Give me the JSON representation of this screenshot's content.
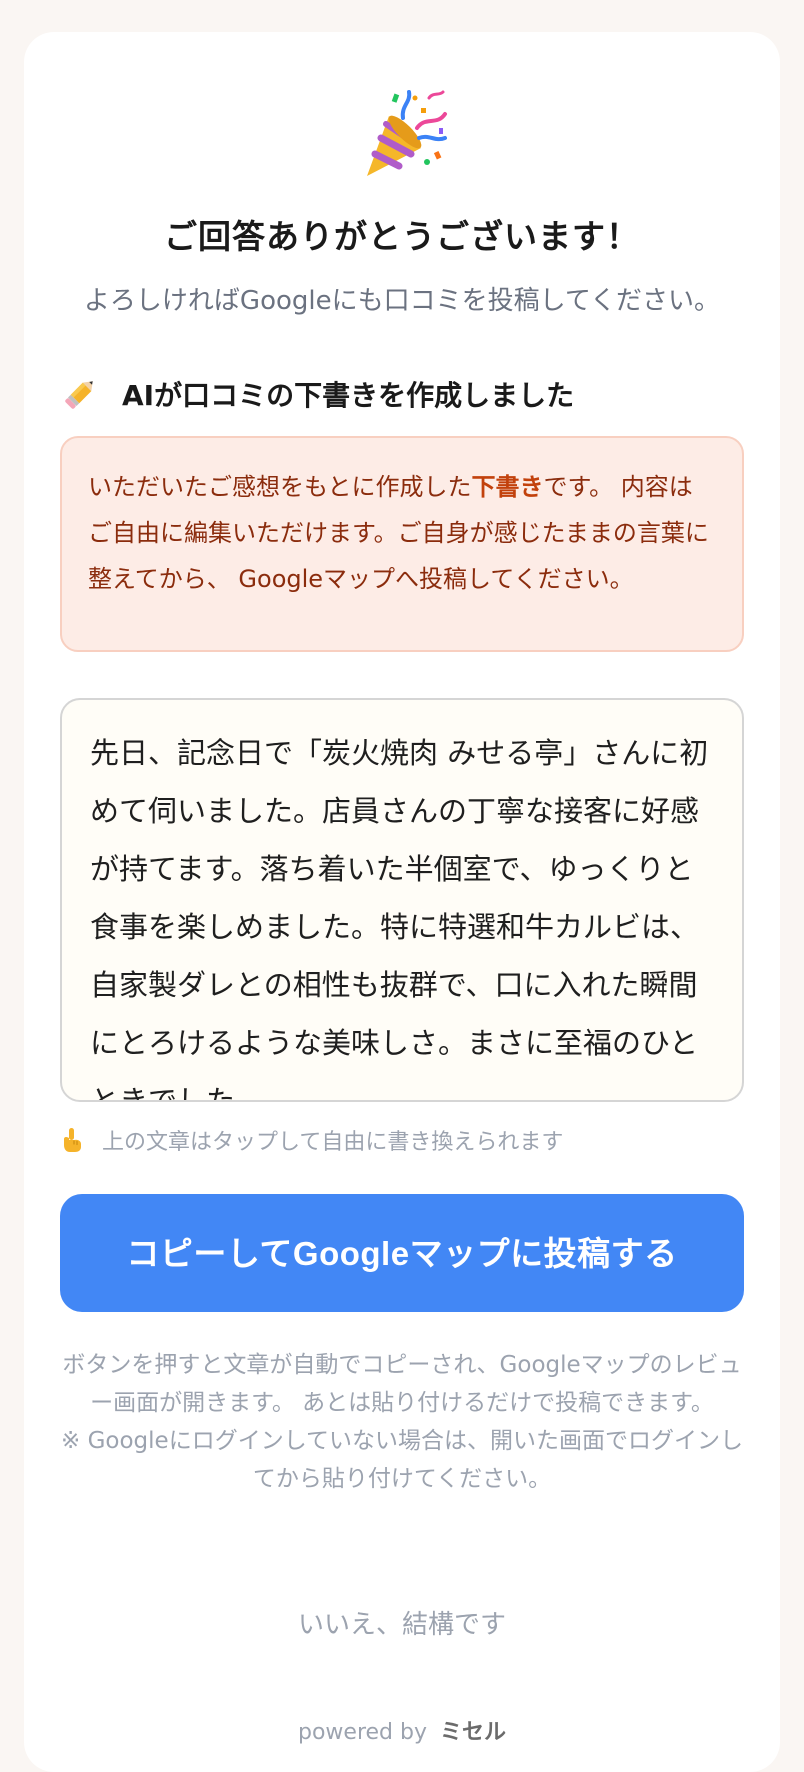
{
  "header": {
    "icon": "party-popper-icon",
    "title": "ご回答ありがとうございます！",
    "subtitle": "よろしければGoogleにも口コミを投稿してください。"
  },
  "section": {
    "icon": "pencil-icon",
    "title": "AIが口コミの下書きを作成しました"
  },
  "notice": {
    "part1": "いただいたご感想をもとに作成した",
    "highlight": "下書き",
    "part2": "です。 内容はご自由に編集いただけます。ご自身が感じたままの言葉に整えてから、 Googleマップへ投稿してください。"
  },
  "draft": {
    "text": "先日、記念日で「炭火焼肉 みせる亭」さんに初めて伺いました。店員さんの丁寧な接客に好感が持てます。落ち着いた半個室で、ゆっくりと食事を楽しめました。特に特選和牛カルビは、自家製ダレとの相性も抜群で、口に入れた瞬間にとろけるような美味しさ。まさに至福のひとときでした。"
  },
  "hint": {
    "icon": "pointing-hand-icon",
    "text": "上の文章はタップして自由に書き換えられます"
  },
  "copy_button": {
    "label": "コピーしてGoogleマップに投稿する"
  },
  "explain": {
    "line1": "ボタンを押すと文章が自動でコピーされ、Googleマップのレビュー画面が開きます。 あとは貼り付けるだけで投稿できます。",
    "line2": "※ Googleにログインしていない場合は、開いた画面でログインしてから貼り付けてください。"
  },
  "decline": {
    "label": "いいえ、結構です"
  },
  "footer": {
    "powered_by": "powered by",
    "brand": "ミセル"
  },
  "colors": {
    "page_bg": "#faf6f3",
    "card_bg": "#ffffff",
    "accent": "#4287f5",
    "notice_bg": "#fdece6",
    "notice_text": "#8b2c0d",
    "notice_highlight": "#c2410c"
  }
}
